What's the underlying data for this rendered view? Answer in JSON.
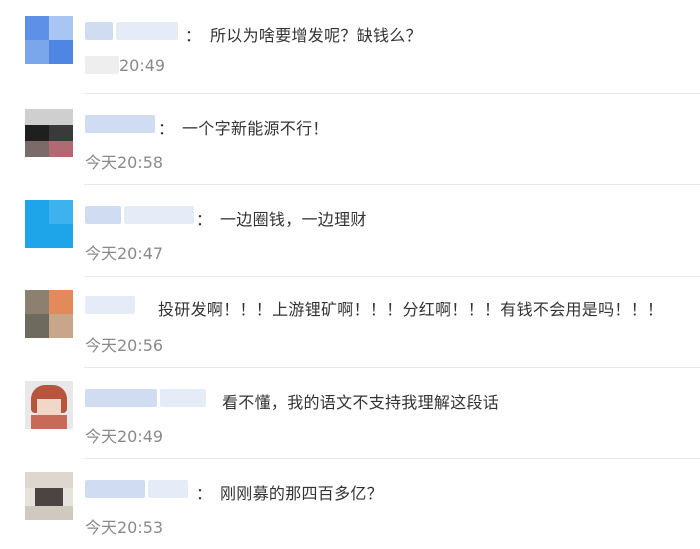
{
  "comments": [
    {
      "text": "所以为啥要增发呢？缺钱么？",
      "time": "20:49",
      "colon": "："
    },
    {
      "text": "一个字新能源不行！",
      "time": "今天20:58",
      "colon": "："
    },
    {
      "text": "一边圈钱，一边理财",
      "time": "今天20:47",
      "colon": "："
    },
    {
      "text": "投研发啊！！！上游锂矿啊！！！分红啊！！！有钱不会用是吗！！！",
      "time": "今天20:56",
      "colon": ""
    },
    {
      "text": "看不懂，我的语文不支持我理解这段话",
      "time": "今天20:49",
      "colon": ""
    },
    {
      "text": "刚刚募的那四百多亿？",
      "time": "今天20:53",
      "colon": "："
    }
  ]
}
